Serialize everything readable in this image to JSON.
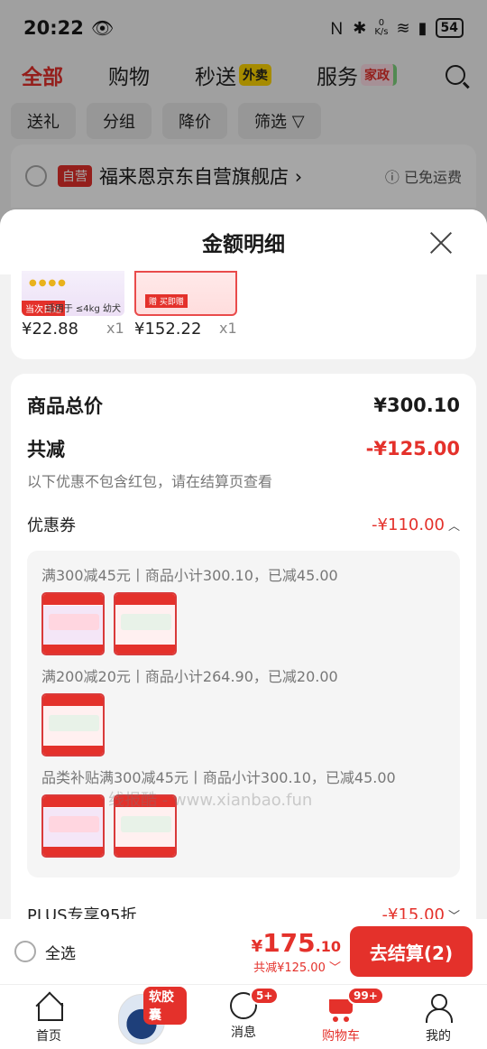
{
  "status_bar": {
    "time": "20:22",
    "network_speed_value": "0",
    "network_speed_unit": "K/s",
    "battery": "54"
  },
  "top_tabs": [
    {
      "label": "全部",
      "active": true
    },
    {
      "label": "购物",
      "active": false
    },
    {
      "label": "秒送",
      "active": false,
      "pill": "外卖"
    },
    {
      "label": "服务",
      "active": false,
      "pill": "家政"
    }
  ],
  "filters": [
    "送礼",
    "分组",
    "降价",
    "筛选"
  ],
  "store": {
    "badge": "自营",
    "name": "福来恩京东自营旗舰店",
    "chevron": "›",
    "shipping": "ⓘ 已免运费"
  },
  "sheet": {
    "title": "金额明细",
    "products": [
      {
        "price": "¥22.88",
        "qty": "x1",
        "tag": "当次日达",
        "subtitle": "适用于 ≤4kg 幼犬"
      },
      {
        "price": "¥152.22",
        "qty": "x1",
        "tag": "赠 买即赠"
      }
    ],
    "total_label": "商品总价",
    "total_value": "¥300.10",
    "discount_label": "共减",
    "discount_value": "-¥125.00",
    "discount_note": "以下优惠不包含红包，请在结算页查看",
    "coupon_label": "优惠券",
    "coupon_value": "-¥110.00",
    "coupon_rules": [
      {
        "text": "满300减45元丨商品小计300.10，已减45.00",
        "items": [
          "a",
          "b"
        ]
      },
      {
        "text": "满200减20元丨商品小计264.90，已减20.00",
        "items": [
          "b"
        ]
      },
      {
        "text": "品类补贴满300减45元丨商品小计300.10，已减45.00",
        "items": [
          "a",
          "b"
        ]
      }
    ],
    "plus_label": "PLUS专享95折",
    "plus_value": "-¥15.00",
    "watermark": "线报酷 - www.xianbao.fun"
  },
  "checkout": {
    "select_all": "全选",
    "price_symbol": "¥",
    "price_int": "175",
    "price_dec": ".10",
    "total_discount": "共减¥125.00",
    "button": "去结算(2)"
  },
  "bottom_nav": [
    {
      "label": "首页",
      "icon": "home-icon"
    },
    {
      "label": "",
      "icon": "promo-bottle",
      "badge": "软胶囊"
    },
    {
      "label": "消息",
      "icon": "message-icon",
      "badge": "5+"
    },
    {
      "label": "购物车",
      "icon": "cart-icon",
      "badge": "99+",
      "active": true
    },
    {
      "label": "我的",
      "icon": "profile-icon"
    }
  ],
  "colors": {
    "accent": "#e4312b",
    "pill_yellow": "#ffd600"
  }
}
